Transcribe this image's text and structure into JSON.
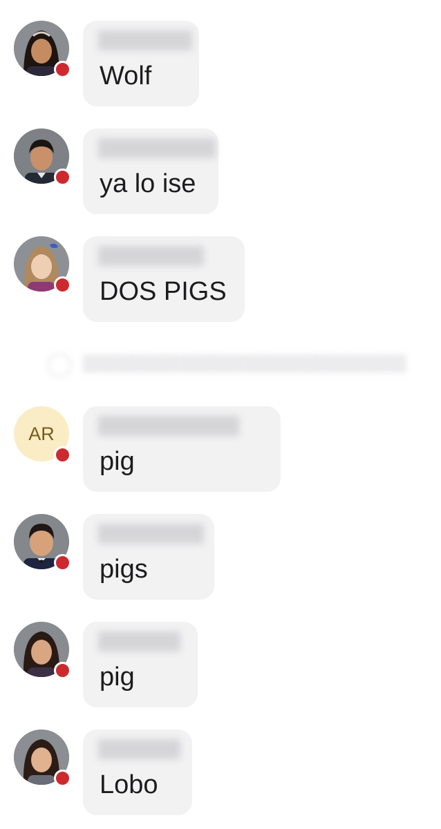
{
  "messages": [
    {
      "avatar": "student-photo-avatar",
      "text": "Wolf"
    },
    {
      "avatar": "student-photo-avatar",
      "text": "ya lo ise"
    },
    {
      "avatar": "student-photo-avatar",
      "text": "DOS PIGS"
    },
    {
      "avatar": "initials-avatar",
      "initials": "AR",
      "text": "pig"
    },
    {
      "avatar": "student-photo-avatar",
      "text": "pigs"
    },
    {
      "avatar": "student-photo-avatar",
      "text": "pig"
    },
    {
      "avatar": "student-photo-avatar",
      "text": "Lobo"
    }
  ],
  "colors": {
    "bubble_background": "#f2f2f3",
    "message_text": "#1c1c1e",
    "status_dot": "#cc2a2f",
    "initials_avatar_background": "#faedc6",
    "initials_avatar_text": "#7a5a1a"
  }
}
